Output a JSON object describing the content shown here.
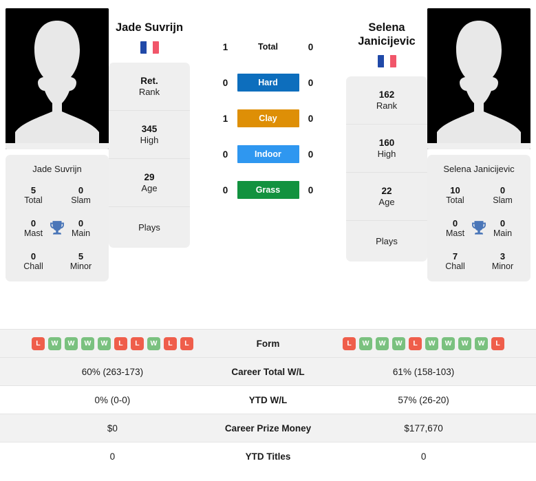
{
  "players": {
    "left": {
      "name": "Jade Suvrijn",
      "name_lines": [
        "Jade Suvrijn"
      ],
      "card_name": "Jade Suvrijn",
      "flag": "france-flag-icon",
      "rank": "Ret.",
      "rank_label": "Rank",
      "high": "345",
      "high_label": "High",
      "age": "29",
      "age_label": "Age",
      "plays_label": "Plays",
      "plays_value": "",
      "titles": {
        "total": "5",
        "total_label": "Total",
        "slam": "0",
        "slam_label": "Slam",
        "mast": "0",
        "mast_label": "Mast",
        "main": "0",
        "main_label": "Main",
        "chall": "0",
        "chall_label": "Chall",
        "minor": "5",
        "minor_label": "Minor"
      },
      "form": [
        "L",
        "W",
        "W",
        "W",
        "W",
        "L",
        "L",
        "W",
        "L",
        "L"
      ],
      "career_total_wl": "60% (263-173)",
      "ytd_wl": "0% (0-0)",
      "career_prize_money": "$0",
      "ytd_titles": "0"
    },
    "right": {
      "name": "Selena Janicijevic",
      "name_lines": [
        "Selena",
        "Janicijevic"
      ],
      "card_name": "Selena Janicijevic",
      "flag": "france-flag-icon",
      "rank": "162",
      "rank_label": "Rank",
      "high": "160",
      "high_label": "High",
      "age": "22",
      "age_label": "Age",
      "plays_label": "Plays",
      "plays_value": "",
      "titles": {
        "total": "10",
        "total_label": "Total",
        "slam": "0",
        "slam_label": "Slam",
        "mast": "0",
        "mast_label": "Mast",
        "main": "0",
        "main_label": "Main",
        "chall": "7",
        "chall_label": "Chall",
        "minor": "3",
        "minor_label": "Minor"
      },
      "form": [
        "L",
        "W",
        "W",
        "W",
        "L",
        "W",
        "W",
        "W",
        "W",
        "L"
      ],
      "career_total_wl": "61% (158-103)",
      "ytd_wl": "57% (26-20)",
      "career_prize_money": "$177,670",
      "ytd_titles": "0"
    }
  },
  "head_to_head": [
    {
      "label": "Total",
      "left": "1",
      "right": "0",
      "style": "plain",
      "color": ""
    },
    {
      "label": "Hard",
      "left": "0",
      "right": "0",
      "style": "surface",
      "color": "#0d6ebd"
    },
    {
      "label": "Clay",
      "left": "1",
      "right": "0",
      "style": "surface",
      "color": "#de8f06"
    },
    {
      "label": "Indoor",
      "left": "0",
      "right": "0",
      "style": "surface",
      "color": "#2f97f0"
    },
    {
      "label": "Grass",
      "left": "0",
      "right": "0",
      "style": "surface",
      "color": "#12923f"
    }
  ],
  "comparison_rows": [
    {
      "label": "Form",
      "key": "form",
      "type": "form",
      "shaded": true
    },
    {
      "label": "Career Total W/L",
      "key": "career_total_wl",
      "type": "text",
      "shaded": true
    },
    {
      "label": "YTD W/L",
      "key": "ytd_wl",
      "type": "text",
      "shaded": false
    },
    {
      "label": "Career Prize Money",
      "key": "career_prize_money",
      "type": "text",
      "shaded": true
    },
    {
      "label": "YTD Titles",
      "key": "ytd_titles",
      "type": "text",
      "shaded": false
    }
  ],
  "colors": {
    "win": "#7ac17f",
    "loss": "#ef5e4b",
    "card_bg": "#eeeeee",
    "trophy": "#4a76b8",
    "flag_blue": "#2049a8",
    "flag_white": "#ffffff",
    "flag_red": "#f1566a"
  }
}
